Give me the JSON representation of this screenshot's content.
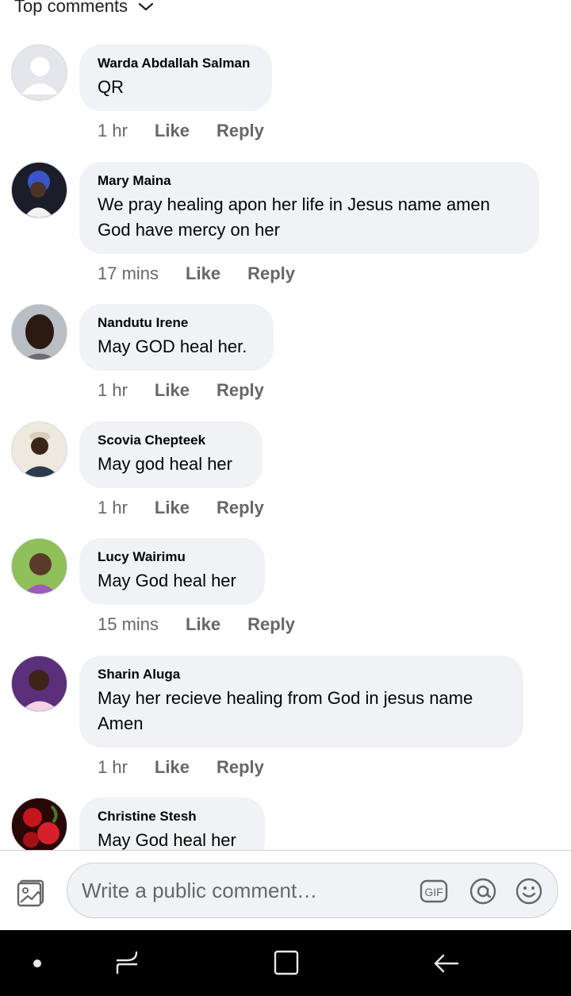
{
  "sort": {
    "label": "Top comments"
  },
  "comments": [
    {
      "author": "Warda Abdallah Salman",
      "text": "QR",
      "time": "1 hr",
      "like": "Like",
      "reply": "Reply"
    },
    {
      "author": "Mary Maina",
      "text": "We pray healing apon her life in Jesus name amen God have mercy on her",
      "time": "17 mins",
      "like": "Like",
      "reply": "Reply"
    },
    {
      "author": "Nandutu Irene",
      "text": "May GOD heal her.",
      "time": "1 hr",
      "like": "Like",
      "reply": "Reply"
    },
    {
      "author": "Scovia Chepteek",
      "text": "May god heal her",
      "time": "1 hr",
      "like": "Like",
      "reply": "Reply"
    },
    {
      "author": "Lucy Wairimu",
      "text": "May God heal her",
      "time": "15 mins",
      "like": "Like",
      "reply": "Reply"
    },
    {
      "author": "Sharin Aluga",
      "text": "May her recieve healing from God in jesus name Amen",
      "time": "1 hr",
      "like": "Like",
      "reply": "Reply"
    },
    {
      "author": "Christine Stesh",
      "text": "May God heal her"
    }
  ],
  "composer": {
    "placeholder": "Write a public comment…",
    "gif_label": "GIF"
  },
  "colors": {
    "bubble": "#f0f2f5",
    "meta": "#65676b",
    "navbar": "#000000"
  },
  "icons": [
    "chevron-down-icon",
    "photo-icon",
    "gif-icon",
    "mention-icon",
    "emoji-icon",
    "nav-dot-icon",
    "recents-icon",
    "home-icon",
    "back-icon"
  ]
}
